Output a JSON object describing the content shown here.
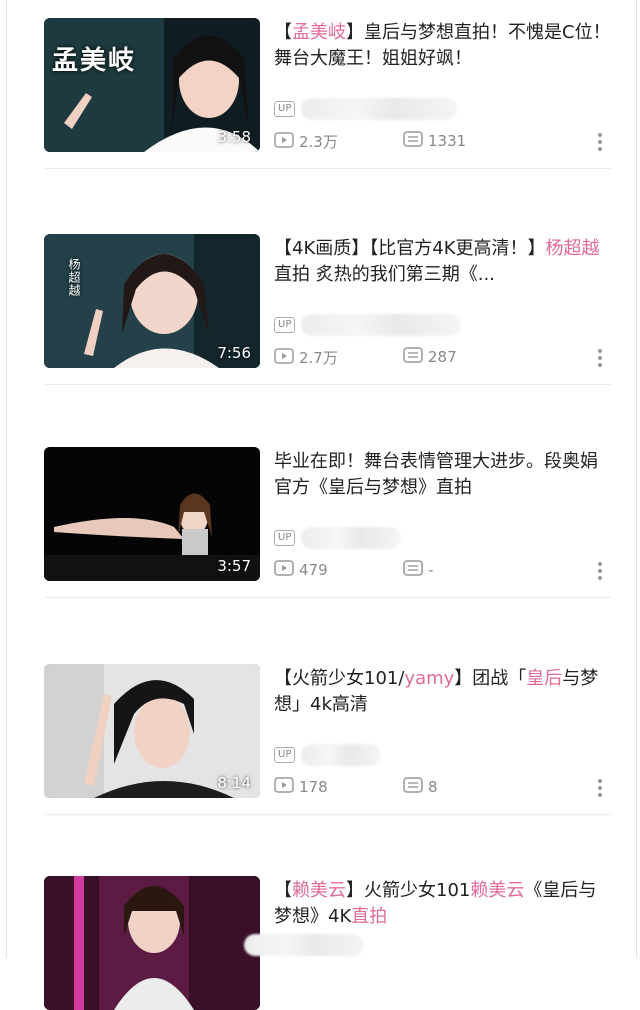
{
  "colors": {
    "accent": "#e06b9a",
    "meta": "#888888",
    "divider": "#ececec"
  },
  "icons": {
    "views": "play-count-icon",
    "comments": "comment-count-icon",
    "more": "more-vertical-icon"
  },
  "up_badge": "UP",
  "videos": [
    {
      "title_parts": [
        {
          "t": "【"
        },
        {
          "t": "孟美岐",
          "hl": true
        },
        {
          "t": "】皇后与梦想直拍！不愧是C位！舞台大魔王！姐姐好飒！"
        }
      ],
      "thumb_caption": "孟美岐",
      "duration": "3:58",
      "views": "2.3万",
      "comments": "1331"
    },
    {
      "title_parts": [
        {
          "t": "【4K画质】【比官方4K更高清！】"
        },
        {
          "t": "杨超越",
          "hl": true
        },
        {
          "t": "直拍 炙热的我们第三期《..."
        }
      ],
      "thumb_caption": "杨超越",
      "duration": "7:56",
      "views": "2.7万",
      "comments": "287"
    },
    {
      "title_parts": [
        {
          "t": "毕业在即！舞台表情管理大进步。段奥娟官方《皇后与梦想》直拍"
        }
      ],
      "thumb_caption": "",
      "duration": "3:57",
      "views": "479",
      "comments": "-"
    },
    {
      "title_parts": [
        {
          "t": "【火箭少女101/"
        },
        {
          "t": "yamy",
          "hl": true
        },
        {
          "t": "】团战「"
        },
        {
          "t": "皇后",
          "hl": true
        },
        {
          "t": "与梦想」4k高清"
        }
      ],
      "thumb_caption": "",
      "duration": "8:14",
      "views": "178",
      "comments": "8"
    },
    {
      "title_parts": [
        {
          "t": "【"
        },
        {
          "t": "赖美云",
          "hl": true
        },
        {
          "t": "】火箭少女101"
        },
        {
          "t": "赖美云",
          "hl": true
        },
        {
          "t": "《皇后与梦想》4K"
        },
        {
          "t": "直拍",
          "hl": true
        }
      ],
      "thumb_caption": "",
      "duration": "",
      "views": "",
      "comments": ""
    }
  ]
}
